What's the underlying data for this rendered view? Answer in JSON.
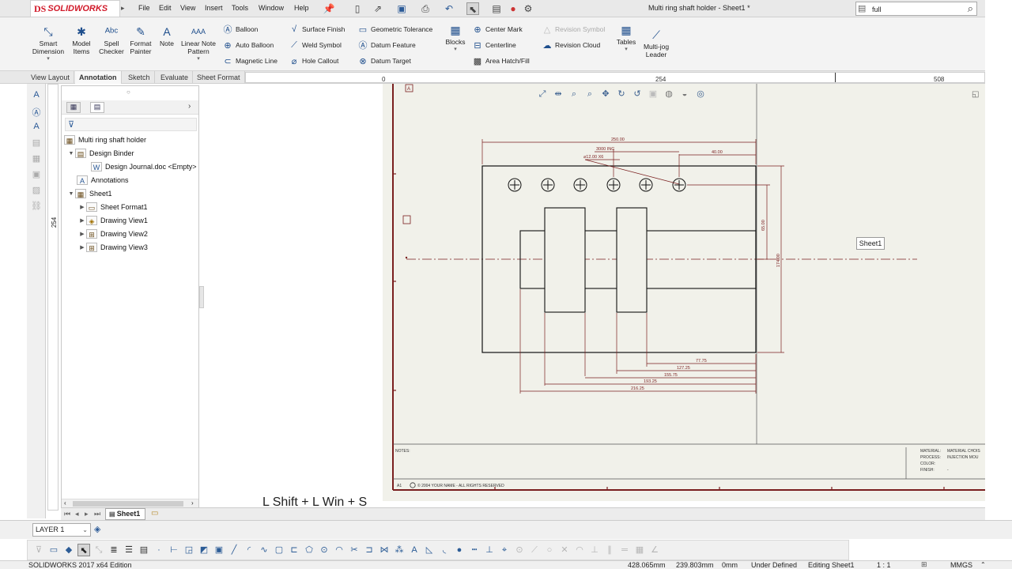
{
  "app": {
    "brand": "SOLIDWORKS",
    "ds_mark": "DS"
  },
  "menu": [
    "File",
    "Edit",
    "View",
    "Insert",
    "Tools",
    "Window",
    "Help"
  ],
  "document_title": "Multi ring shaft holder - Sheet1 *",
  "search": {
    "value": "full"
  },
  "ribbon": {
    "big_buttons": [
      {
        "label": "Smart Dimension"
      },
      {
        "label": "Model Items"
      },
      {
        "label": "Spell Checker"
      },
      {
        "label": "Format Painter"
      },
      {
        "label": "Note"
      },
      {
        "label": "Linear Note Pattern"
      }
    ],
    "col1": [
      "Balloon",
      "Auto Balloon",
      "Magnetic Line"
    ],
    "col2": [
      "Surface Finish",
      "Weld Symbol",
      "Hole Callout"
    ],
    "col3": [
      "Geometric Tolerance",
      "Datum Feature",
      "Datum Target"
    ],
    "blocks": "Blocks",
    "col4": [
      "Center Mark",
      "Centerline",
      "Area Hatch/Fill"
    ],
    "col5": [
      "Revision Symbol",
      "Revision Cloud"
    ],
    "tables": "Tables",
    "multijog": "Multi-jog Leader"
  },
  "tabs": [
    "View Layout",
    "Annotation",
    "Sketch",
    "Evaluate",
    "Sheet Format"
  ],
  "active_tab": "Annotation",
  "ruler": {
    "marks": [
      "0",
      "254",
      "508"
    ],
    "vmark": "254"
  },
  "tree": {
    "nodes": [
      {
        "label": "Multi ring shaft holder",
        "level": 0,
        "toggle": ""
      },
      {
        "label": "Design Binder",
        "level": 1,
        "toggle": "▼"
      },
      {
        "label": "Design Journal.doc <Empty>",
        "level": 2,
        "toggle": ""
      },
      {
        "label": "Annotations",
        "level": 1,
        "toggle": ""
      },
      {
        "label": "Sheet1",
        "level": 1,
        "toggle": "▼"
      },
      {
        "label": "Sheet Format1",
        "level": 2,
        "toggle": "▶"
      },
      {
        "label": "Drawing View1",
        "level": 2,
        "toggle": "▶"
      },
      {
        "label": "Drawing View2",
        "level": 2,
        "toggle": "▶"
      },
      {
        "label": "Drawing View3",
        "level": 2,
        "toggle": "▶"
      }
    ]
  },
  "drawing": {
    "sheet_label": "Sheet1",
    "zone_label": "A",
    "dims": {
      "overall_width": "250.00",
      "hole_spacing": "3000 INC",
      "hole_callout": "⌀12.00 X6",
      "edge_offset": "40.00",
      "height_right_inner": "65.00",
      "height_right_outer": "174.00",
      "d1": "77.75",
      "d2": "127.25",
      "d3": "155.75",
      "d4": "193.25",
      "d5": "216.25"
    },
    "notes_label": "NOTES:",
    "title_fields": [
      "MATERIAL:",
      "PROCESS:",
      "COLOR:",
      "FINISH:"
    ],
    "title_values": [
      "MATERIAL CHOIS",
      "INJECTION MOU",
      "",
      "-"
    ],
    "sheet_size": "A1",
    "copyright": "© 2004 YOUR NAME - ALL RIGHTS RESERVED"
  },
  "shortcut_text": "L Shift + L Win + S",
  "sheet_tab": "Sheet1",
  "layer": "LAYER 1",
  "status": {
    "edition": "SOLIDWORKS 2017 x64 Edition",
    "x": "428.065mm",
    "y": "239.803mm",
    "z": "0mm",
    "state": "Under Defined",
    "editing": "Editing Sheet1",
    "scale": "1 : 1",
    "units": "MMGS"
  }
}
